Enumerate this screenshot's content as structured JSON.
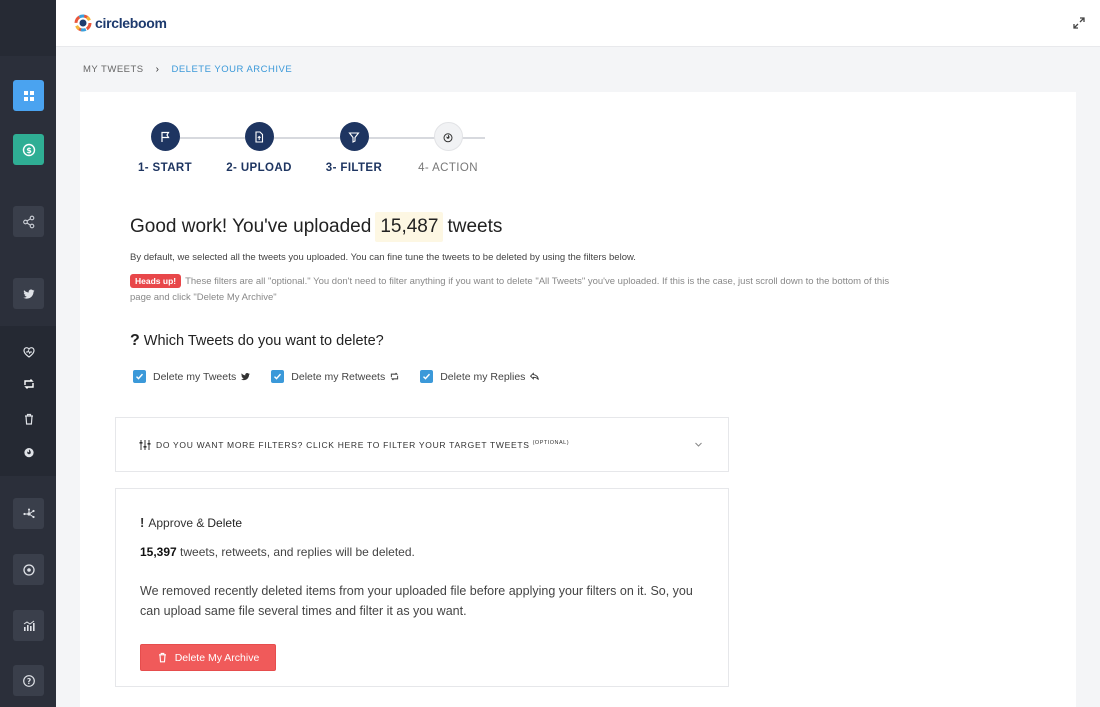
{
  "app": {
    "logo_text": "circleboom"
  },
  "breadcrumb": {
    "parent": "MY TWEETS",
    "separator": "›",
    "current": "DELETE YOUR ARCHIVE"
  },
  "steps": [
    {
      "label": "1- START",
      "icon": "flag-icon",
      "state": "done"
    },
    {
      "label": "2- UPLOAD",
      "icon": "file-upload-icon",
      "state": "done"
    },
    {
      "label": "3- FILTER",
      "icon": "filter-icon",
      "state": "done"
    },
    {
      "label": "4- ACTION",
      "icon": "fire-icon",
      "state": "pending"
    }
  ],
  "summary": {
    "headline_prefix": "Good work! You've uploaded",
    "count": "15,487",
    "headline_suffix": "tweets",
    "subtext": "By default, we selected all the tweets you uploaded. You can fine tune the tweets to be deleted by using the filters below.",
    "headsup_badge": "Heads up!",
    "headsup_text": "These filters are all \"optional.\" You don't need to filter anything if you want to delete \"All Tweets\" you've uploaded. If this is the case, just scroll down to the bottom of this page and click \"Delete My Archive\""
  },
  "question": {
    "mark": "?",
    "text": "Which Tweets do you want to delete?"
  },
  "options": [
    {
      "label": "Delete my Tweets",
      "checked": true,
      "icon": "twitter-icon"
    },
    {
      "label": "Delete my Retweets",
      "checked": true,
      "icon": "retweet-icon"
    },
    {
      "label": "Delete my Replies",
      "checked": true,
      "icon": "reply-icon"
    }
  ],
  "filters": {
    "text": "DO YOU WANT MORE FILTERS? CLICK HERE TO FILTER YOUR TARGET TWEETS",
    "optional": "(OPTIONAL)"
  },
  "approve": {
    "mark": "!",
    "title_prefix": "Approve &",
    "title_bold": "Delete",
    "count": "15,397",
    "count_mid": "tweets, retweets, and replies",
    "count_suffix": "will be deleted.",
    "note": "We removed recently deleted items from your uploaded file before applying your filters on it. So, you can upload same file several times and filter it as you want.",
    "button_label": "Delete My Archive"
  },
  "colors": {
    "navy": "#1e3561",
    "accent_blue": "#3b99d9",
    "danger": "#f05a5a",
    "sidebar": "#2b2f3a"
  }
}
